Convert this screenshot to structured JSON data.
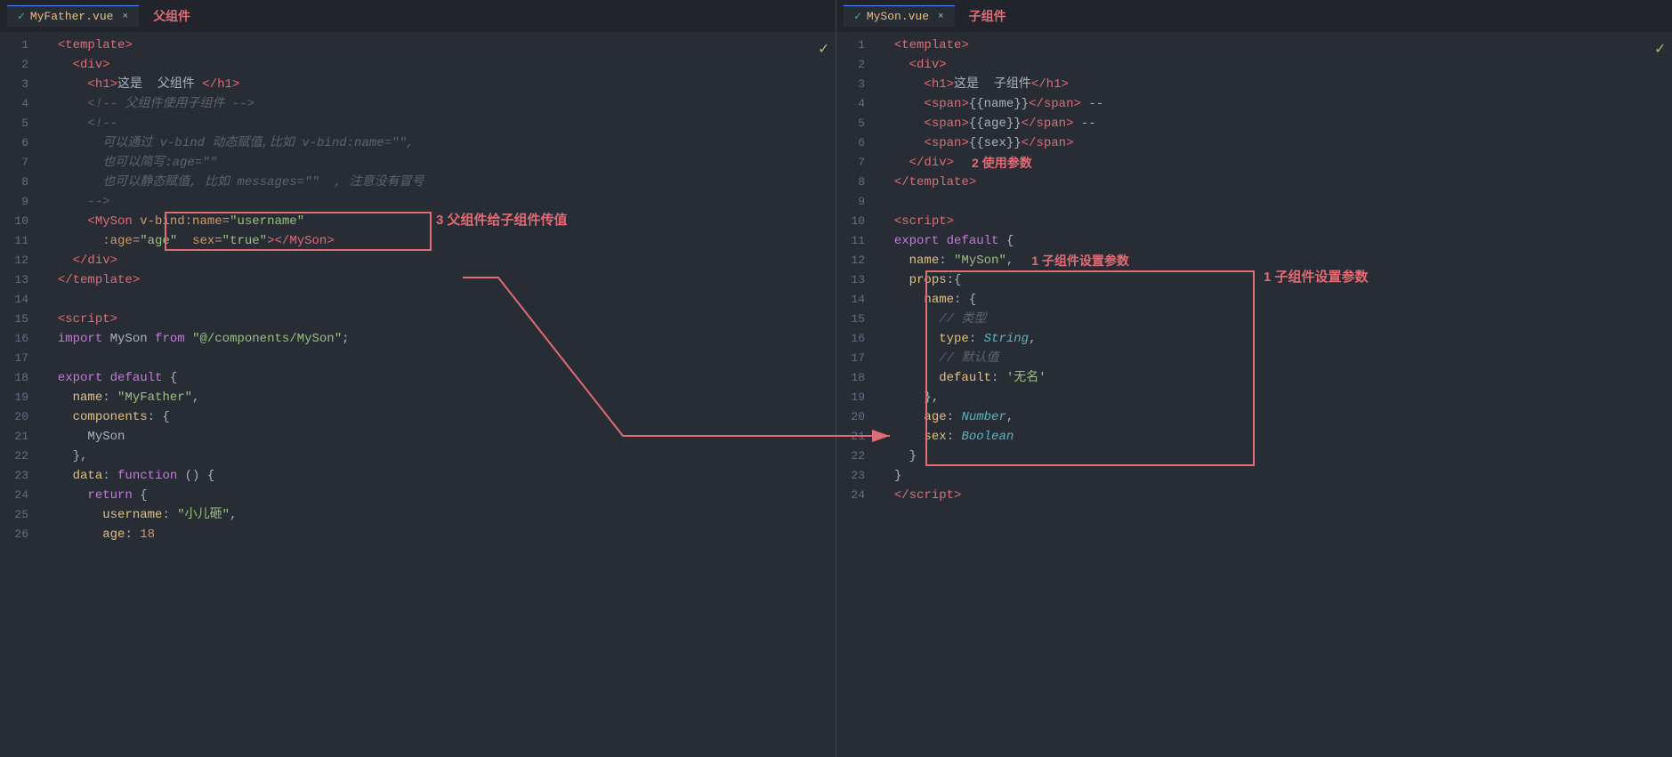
{
  "leftPane": {
    "tab": {
      "icon": "✓",
      "filename": "MyFather.vue",
      "closeBtn": "×",
      "label": "父组件"
    },
    "checkmark": "✓",
    "lines": [
      {
        "num": 1,
        "tokens": [
          {
            "t": "  ",
            "c": ""
          },
          {
            "t": "<",
            "c": "tag"
          },
          {
            "t": "template",
            "c": "tag"
          },
          {
            "t": ">",
            "c": "tag"
          }
        ]
      },
      {
        "num": 2,
        "tokens": [
          {
            "t": "    ",
            "c": ""
          },
          {
            "t": "<",
            "c": "tag"
          },
          {
            "t": "div",
            "c": "tag"
          },
          {
            "t": ">",
            "c": "tag"
          }
        ]
      },
      {
        "num": 3,
        "tokens": [
          {
            "t": "      ",
            "c": ""
          },
          {
            "t": "<",
            "c": "tag"
          },
          {
            "t": "h1",
            "c": "tag"
          },
          {
            "t": ">",
            "c": "tag"
          },
          {
            "t": "这是  父组件 ",
            "c": "white"
          },
          {
            "t": "</",
            "c": "tag"
          },
          {
            "t": "h1",
            "c": "tag"
          },
          {
            "t": ">",
            "c": "tag"
          }
        ]
      },
      {
        "num": 4,
        "tokens": [
          {
            "t": "      ",
            "c": ""
          },
          {
            "t": "<!-- 父组件使用子组件 -->",
            "c": "comment"
          }
        ]
      },
      {
        "num": 5,
        "tokens": [
          {
            "t": "      ",
            "c": ""
          },
          {
            "t": "<!--",
            "c": "comment"
          }
        ]
      },
      {
        "num": 6,
        "tokens": [
          {
            "t": "        ",
            "c": ""
          },
          {
            "t": "可以通过 v-bind 动态赋值,比如 v-bind:name=\"\",",
            "c": "comment"
          }
        ]
      },
      {
        "num": 7,
        "tokens": [
          {
            "t": "        ",
            "c": ""
          },
          {
            "t": "也可以简写:age=\"\"",
            "c": "comment"
          }
        ]
      },
      {
        "num": 8,
        "tokens": [
          {
            "t": "        ",
            "c": ""
          },
          {
            "t": "也可以静态赋值, 比如 messages=\"\"  , 注意没有冒号",
            "c": "comment"
          }
        ]
      },
      {
        "num": 9,
        "tokens": [
          {
            "t": "      ",
            "c": ""
          },
          {
            "t": "-->",
            "c": "comment"
          }
        ]
      },
      {
        "num": 10,
        "tokens": [
          {
            "t": "      ",
            "c": ""
          },
          {
            "t": "<",
            "c": "tag"
          },
          {
            "t": "MySon ",
            "c": "tag"
          },
          {
            "t": "v-bind:name=",
            "c": "attr"
          },
          {
            "t": "\"username\"",
            "c": "str"
          }
        ],
        "annotationBox": true
      },
      {
        "num": 11,
        "tokens": [
          {
            "t": "        ",
            "c": ""
          },
          {
            "t": ":age=",
            "c": "attr"
          },
          {
            "t": "\"age\"",
            "c": "str"
          },
          {
            "t": "  ",
            "c": ""
          },
          {
            "t": "sex=",
            "c": "attr"
          },
          {
            "t": "\"true\"",
            "c": "str"
          },
          {
            "t": ">",
            "c": "tag"
          },
          {
            "t": "</",
            "c": "tag"
          },
          {
            "t": "MySon",
            "c": "tag"
          },
          {
            "t": ">",
            "c": "tag"
          }
        ]
      },
      {
        "num": 12,
        "tokens": [
          {
            "t": "    ",
            "c": ""
          },
          {
            "t": "</",
            "c": "tag"
          },
          {
            "t": "div",
            "c": "tag"
          },
          {
            "t": ">",
            "c": "tag"
          }
        ]
      },
      {
        "num": 13,
        "tokens": [
          {
            "t": "  ",
            "c": ""
          },
          {
            "t": "</",
            "c": "tag"
          },
          {
            "t": "template",
            "c": "tag"
          },
          {
            "t": ">",
            "c": "tag"
          }
        ]
      },
      {
        "num": 14,
        "tokens": []
      },
      {
        "num": 15,
        "tokens": [
          {
            "t": "  ",
            "c": ""
          },
          {
            "t": "<",
            "c": "tag"
          },
          {
            "t": "script",
            "c": "tag"
          },
          {
            "t": ">",
            "c": "tag"
          }
        ]
      },
      {
        "num": 16,
        "tokens": [
          {
            "t": "  ",
            "c": ""
          },
          {
            "t": "import ",
            "c": "purple"
          },
          {
            "t": "MySon ",
            "c": "white"
          },
          {
            "t": "from ",
            "c": "purple"
          },
          {
            "t": "\"@/components/MySon\"",
            "c": "green"
          },
          {
            "t": ";",
            "c": "white"
          }
        ]
      },
      {
        "num": 17,
        "tokens": []
      },
      {
        "num": 18,
        "tokens": [
          {
            "t": "  ",
            "c": ""
          },
          {
            "t": "export ",
            "c": "purple"
          },
          {
            "t": "default ",
            "c": "purple"
          },
          {
            "t": "{",
            "c": "white"
          }
        ]
      },
      {
        "num": 19,
        "tokens": [
          {
            "t": "    ",
            "c": ""
          },
          {
            "t": "name",
            "c": "prop"
          },
          {
            "t": ": ",
            "c": "white"
          },
          {
            "t": "\"MyFather\"",
            "c": "green"
          },
          {
            "t": ",",
            "c": "white"
          }
        ]
      },
      {
        "num": 20,
        "tokens": [
          {
            "t": "    ",
            "c": ""
          },
          {
            "t": "components",
            "c": "prop"
          },
          {
            "t": ": {",
            "c": "white"
          }
        ]
      },
      {
        "num": 21,
        "tokens": [
          {
            "t": "      ",
            "c": ""
          },
          {
            "t": "MySon",
            "c": "white"
          }
        ]
      },
      {
        "num": 22,
        "tokens": [
          {
            "t": "    ",
            "c": ""
          },
          {
            "t": "},",
            "c": "white"
          }
        ]
      },
      {
        "num": 23,
        "tokens": [
          {
            "t": "    ",
            "c": ""
          },
          {
            "t": "data",
            "c": "prop"
          },
          {
            "t": ": ",
            "c": "white"
          },
          {
            "t": "function",
            "c": "purple"
          },
          {
            "t": " () {",
            "c": "white"
          }
        ]
      },
      {
        "num": 24,
        "tokens": [
          {
            "t": "      ",
            "c": ""
          },
          {
            "t": "return",
            "c": "purple"
          },
          {
            "t": " {",
            "c": "white"
          }
        ]
      },
      {
        "num": 25,
        "tokens": [
          {
            "t": "        ",
            "c": ""
          },
          {
            "t": "username",
            "c": "prop"
          },
          {
            "t": ": ",
            "c": "white"
          },
          {
            "t": "\"小儿砸\"",
            "c": "green"
          },
          {
            "t": ",",
            "c": "white"
          }
        ]
      },
      {
        "num": 26,
        "tokens": [
          {
            "t": "        ",
            "c": ""
          },
          {
            "t": "age",
            "c": "prop"
          },
          {
            "t": ": ",
            "c": "white"
          },
          {
            "t": "18",
            "c": "orange"
          }
        ]
      }
    ]
  },
  "rightPane": {
    "tab": {
      "icon": "✓",
      "filename": "MySon.vue",
      "closeBtn": "×",
      "label": "子组件"
    },
    "checkmark": "✓",
    "lines": [
      {
        "num": 1,
        "tokens": [
          {
            "t": "  ",
            "c": ""
          },
          {
            "t": "<",
            "c": "tag"
          },
          {
            "t": "template",
            "c": "tag"
          },
          {
            "t": ">",
            "c": "tag"
          }
        ]
      },
      {
        "num": 2,
        "tokens": [
          {
            "t": "    ",
            "c": ""
          },
          {
            "t": "<",
            "c": "tag"
          },
          {
            "t": "div",
            "c": "tag"
          },
          {
            "t": ">",
            "c": "tag"
          }
        ]
      },
      {
        "num": 3,
        "tokens": [
          {
            "t": "      ",
            "c": ""
          },
          {
            "t": "<",
            "c": "tag"
          },
          {
            "t": "h1",
            "c": "tag"
          },
          {
            "t": ">",
            "c": "tag"
          },
          {
            "t": "这是  子组件",
            "c": "white"
          },
          {
            "t": "</",
            "c": "tag"
          },
          {
            "t": "h1",
            "c": "tag"
          },
          {
            "t": ">",
            "c": "tag"
          }
        ]
      },
      {
        "num": 4,
        "tokens": [
          {
            "t": "      ",
            "c": ""
          },
          {
            "t": "<",
            "c": "tag"
          },
          {
            "t": "span",
            "c": "tag"
          },
          {
            "t": ">",
            "c": "tag"
          },
          {
            "t": "{{name}}",
            "c": "white"
          },
          {
            "t": "</",
            "c": "tag"
          },
          {
            "t": "span",
            "c": "tag"
          },
          {
            "t": ">",
            "c": "tag"
          },
          {
            "t": " --",
            "c": "white"
          }
        ]
      },
      {
        "num": 5,
        "tokens": [
          {
            "t": "      ",
            "c": ""
          },
          {
            "t": "<",
            "c": "tag"
          },
          {
            "t": "span",
            "c": "tag"
          },
          {
            "t": ">",
            "c": "tag"
          },
          {
            "t": "{{age}}",
            "c": "white"
          },
          {
            "t": "</",
            "c": "tag"
          },
          {
            "t": "span",
            "c": "tag"
          },
          {
            "t": ">",
            "c": "tag"
          },
          {
            "t": " --",
            "c": "white"
          }
        ]
      },
      {
        "num": 6,
        "tokens": [
          {
            "t": "      ",
            "c": ""
          },
          {
            "t": "<",
            "c": "tag"
          },
          {
            "t": "span",
            "c": "tag"
          },
          {
            "t": ">",
            "c": "tag"
          },
          {
            "t": "{{sex}}",
            "c": "white"
          },
          {
            "t": "</",
            "c": "tag"
          },
          {
            "t": "span",
            "c": "tag"
          },
          {
            "t": ">",
            "c": "tag"
          }
        ]
      },
      {
        "num": 7,
        "tokens": [
          {
            "t": "    ",
            "c": ""
          },
          {
            "t": "</",
            "c": "tag"
          },
          {
            "t": "div",
            "c": "tag"
          },
          {
            "t": ">",
            "c": "tag"
          }
        ],
        "annotation": "2 使用参数"
      },
      {
        "num": 8,
        "tokens": [
          {
            "t": "  ",
            "c": ""
          },
          {
            "t": "</",
            "c": "tag"
          },
          {
            "t": "template",
            "c": "tag"
          },
          {
            "t": ">",
            "c": "tag"
          }
        ]
      },
      {
        "num": 9,
        "tokens": []
      },
      {
        "num": 10,
        "tokens": [
          {
            "t": "  ",
            "c": ""
          },
          {
            "t": "<",
            "c": "tag"
          },
          {
            "t": "script",
            "c": "tag"
          },
          {
            "t": ">",
            "c": "tag"
          }
        ]
      },
      {
        "num": 11,
        "tokens": [
          {
            "t": "  ",
            "c": ""
          },
          {
            "t": "export ",
            "c": "purple"
          },
          {
            "t": "default ",
            "c": "purple"
          },
          {
            "t": "{",
            "c": "white"
          }
        ]
      },
      {
        "num": 12,
        "tokens": [
          {
            "t": "    ",
            "c": ""
          },
          {
            "t": "name",
            "c": "prop"
          },
          {
            "t": ": ",
            "c": "white"
          },
          {
            "t": "\"MySon\"",
            "c": "green"
          },
          {
            "t": ",",
            "c": "white"
          }
        ],
        "annotation": "1 子组件设置参数"
      },
      {
        "num": 13,
        "tokens": [
          {
            "t": "    ",
            "c": ""
          },
          {
            "t": "props",
            "c": "prop"
          },
          {
            "t": ":{",
            "c": "white"
          }
        ]
      },
      {
        "num": 14,
        "tokens": [
          {
            "t": "      ",
            "c": ""
          },
          {
            "t": "name",
            "c": "prop"
          },
          {
            "t": ": {",
            "c": "white"
          }
        ]
      },
      {
        "num": 15,
        "tokens": [
          {
            "t": "        ",
            "c": ""
          },
          {
            "t": "// 类型",
            "c": "comment"
          }
        ]
      },
      {
        "num": 16,
        "tokens": [
          {
            "t": "        ",
            "c": ""
          },
          {
            "t": "type",
            "c": "prop"
          },
          {
            "t": ": ",
            "c": "white"
          },
          {
            "t": "String",
            "c": "cyan italic"
          },
          {
            "t": ",",
            "c": "white"
          }
        ]
      },
      {
        "num": 17,
        "tokens": [
          {
            "t": "        ",
            "c": ""
          },
          {
            "t": "// 默认值",
            "c": "comment"
          }
        ]
      },
      {
        "num": 18,
        "tokens": [
          {
            "t": "        ",
            "c": ""
          },
          {
            "t": "default",
            "c": "prop"
          },
          {
            "t": ": ",
            "c": "white"
          },
          {
            "t": "'无名'",
            "c": "green"
          }
        ]
      },
      {
        "num": 19,
        "tokens": [
          {
            "t": "      ",
            "c": ""
          },
          {
            "t": "},",
            "c": "white"
          }
        ]
      },
      {
        "num": 20,
        "tokens": [
          {
            "t": "      ",
            "c": ""
          },
          {
            "t": "age",
            "c": "prop"
          },
          {
            "t": ": ",
            "c": "white"
          },
          {
            "t": "Number",
            "c": "cyan italic"
          },
          {
            "t": ",",
            "c": "white"
          }
        ]
      },
      {
        "num": 21,
        "tokens": [
          {
            "t": "      ",
            "c": ""
          },
          {
            "t": "sex",
            "c": "prop"
          },
          {
            "t": ": ",
            "c": "white"
          },
          {
            "t": "Boolean",
            "c": "cyan italic"
          }
        ]
      },
      {
        "num": 22,
        "tokens": [
          {
            "t": "    ",
            "c": ""
          },
          {
            "t": "}",
            "c": "white"
          }
        ]
      },
      {
        "num": 23,
        "tokens": [
          {
            "t": "  ",
            "c": ""
          },
          {
            "t": "}",
            "c": "white"
          }
        ]
      },
      {
        "num": 24,
        "tokens": [
          {
            "t": "  ",
            "c": ""
          },
          {
            "t": "</",
            "c": "tag"
          },
          {
            "t": "script",
            "c": "tag"
          },
          {
            "t": ">",
            "c": "tag"
          }
        ]
      }
    ]
  },
  "annotations": {
    "leftBox": {
      "label": "3 父组件给子组件传值"
    },
    "rightBox1": {
      "label": "1 子组件设置参数"
    },
    "rightBox2": {
      "label": "2 使用参数"
    }
  }
}
